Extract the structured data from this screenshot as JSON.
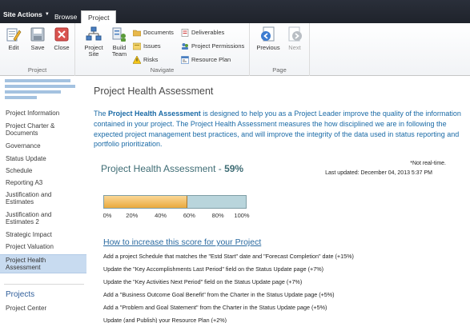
{
  "topbar": {
    "site_actions": "Site Actions",
    "tabs": [
      {
        "label": "Browse",
        "active": false
      },
      {
        "label": "Project",
        "active": true
      }
    ]
  },
  "ribbon": {
    "groups": [
      {
        "label": "Project",
        "buttons": [
          "Edit",
          "Save",
          "Close"
        ]
      },
      {
        "label": "Navigate",
        "big_buttons": [
          "Project Site",
          "Build Team"
        ],
        "small_buttons": [
          "Documents",
          "Issues",
          "Risks",
          "Deliverables",
          "Project Permissions",
          "Resource Plan"
        ]
      },
      {
        "label": "Page",
        "buttons": [
          "Previous",
          "Next"
        ]
      }
    ]
  },
  "leftnav": {
    "items": [
      {
        "label": "Project Information"
      },
      {
        "label": "Project Charter & Documents"
      },
      {
        "label": "Governance"
      },
      {
        "label": "Status Update"
      },
      {
        "label": "Schedule"
      },
      {
        "label": "Reporting A3"
      },
      {
        "label": "Justification and Estimates"
      },
      {
        "label": "Justification and Estimates 2"
      },
      {
        "label": "Strategic Impact"
      },
      {
        "label": "Project Valuation"
      },
      {
        "label": "Project Health Assessment",
        "selected": true
      }
    ],
    "heading": "Projects",
    "footer_item": "Project Center"
  },
  "content": {
    "title": "Project Health Assessment",
    "intro_prefix": "The ",
    "intro_bold": "Project Health Assessment",
    "intro_suffix": " is designed to help you as a Project Leader improve the quality of the information contained in your project. The Project Health Assessment measures the how disciplined we are in following the expected project management best practices, and will improve the integrity of the data used in status reporting and portfolio prioritization.",
    "score_title": "Project Health Assessment - ",
    "score_pct": "59%",
    "score_value": 0.59,
    "not_realtime": "*Not real-time.",
    "last_updated": "Last updated: December 04, 2013 5:37 PM",
    "bar_ticks": [
      "0%",
      "20%",
      "40%",
      "60%",
      "80%",
      "100%"
    ],
    "howto_link": "How to increase this score for your Project",
    "tips": [
      "Add a project Schedule that matches the \"Estd Start\" date and \"Forecast Completion\" date (+15%)",
      "Update the \"Key Accomplishments Last Period\" field on the Status Update page (+7%)",
      "Update the \"Key Activities Next Period\" field on the Status Update page (+7%)",
      "Add a \"Business Outcome Goal Benefit\" from the Charter in the Status Update page (+5%)",
      "Add a \"Problem and Goal Statement\" from the Charter in the Status Update page (+5%)",
      "Update (and Publish) your Resource Plan (+2%)"
    ]
  },
  "colors": {
    "topbar": "#1f232b",
    "link_blue": "#1a6aa6",
    "nav_selected": "#c8dbf0",
    "bar_fill": "#e9a93c",
    "bar_track": "#b9d5dc"
  }
}
